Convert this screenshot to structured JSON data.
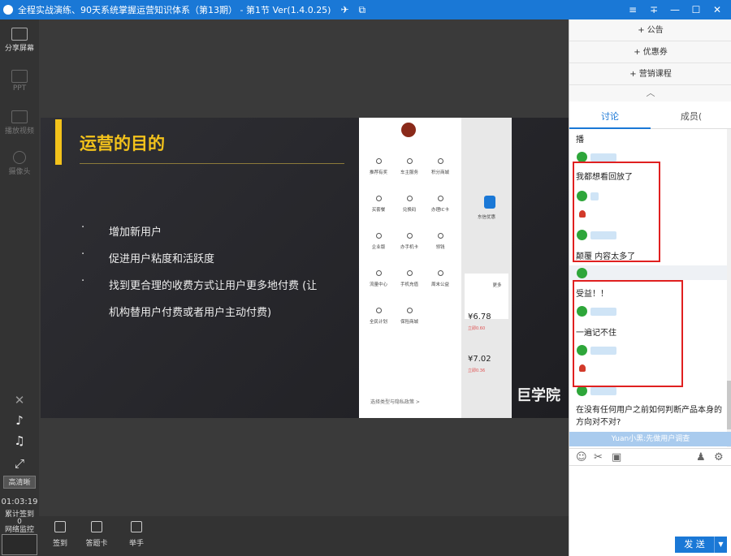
{
  "window": {
    "title": "全程实战演练、90天系统掌握运营知识体系（第13期） - 第1节 Ver(1.4.0.25)",
    "controls": [
      "≡",
      "∓",
      "—",
      "☐",
      "✕"
    ]
  },
  "left_toolbar": {
    "items": [
      {
        "label": "分享屏幕",
        "icon": "share-screen-icon"
      },
      {
        "label": "PPT",
        "icon": "ppt-icon"
      },
      {
        "label": "播放视频",
        "icon": "video-icon"
      },
      {
        "label": "摄像头",
        "icon": "camera-icon"
      }
    ],
    "mic_icon": "mic-off-icon",
    "volume_icon": "volume-icon",
    "music_icon": "music-icon",
    "fullscreen_icon": "fullscreen-icon",
    "quality_button": "高清晰",
    "timer": "01:03:19",
    "cumulative_label": "累计签到",
    "cumulative_value": "0",
    "network_label": "网络监控"
  },
  "slide": {
    "title": "运营的目的",
    "bullets": [
      "增加新用户",
      "促进用户粘度和活跃度",
      "找到更合理的收费方式让用户更多地付费 (让",
      "机构替用户付费或者用户主动付费)"
    ],
    "watermark": "巨学院",
    "phone": {
      "items": [
        "推荐有奖",
        "车主服务",
        "积分商城",
        "买套餐",
        "兑换码",
        "办理IC卡",
        "企业版",
        "办手机卡",
        "领钱",
        "流量中心",
        "手机充值",
        "周末公益",
        "全民计划",
        "保险商城"
      ],
      "link": "选择类型与隐私政策 >",
      "right_items": [
        "东信优惠",
        "更多"
      ],
      "prices": [
        "¥6.78",
        "¥7.02"
      ],
      "price_subs": [
        "立即0.60",
        "立即0.36"
      ]
    }
  },
  "bottom_toolbar": {
    "items": [
      {
        "label": "签到",
        "icon": "checkin-icon"
      },
      {
        "label": "答题卡",
        "icon": "answer-card-icon"
      },
      {
        "label": "举手",
        "icon": "raise-hand-icon"
      }
    ]
  },
  "right_panel": {
    "accordion": [
      "+ 公告",
      "+ 优惠券",
      "+ 营销课程"
    ],
    "tabs": [
      "讨论",
      "成员("
    ],
    "messages": [
      {
        "text": "播"
      },
      {
        "text": "我都想看回放了"
      },
      {
        "text": "颠覆 内容太多了"
      },
      {
        "text": "受益！！"
      },
      {
        "text": "一遍记不住"
      },
      {
        "text": "在没有任何用户之前如何判断产品本身的"
      },
      {
        "text": "方向对不对?"
      }
    ],
    "notice": "Yuan小黑:先做用户调查",
    "send_label": "发 送",
    "send_arrow": "▼"
  }
}
